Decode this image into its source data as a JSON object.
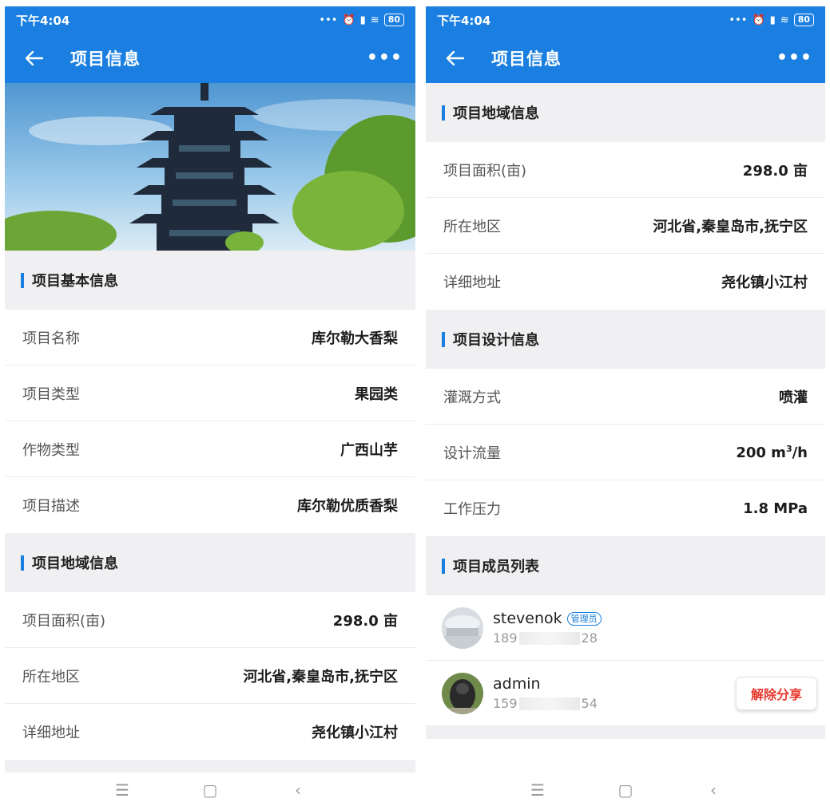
{
  "status_bar": {
    "time": "下午4:04",
    "battery": "80"
  },
  "app_bar": {
    "title": "项目信息"
  },
  "sections": {
    "basic": {
      "title": "项目基本信息",
      "rows": [
        {
          "label": "项目名称",
          "value": "库尔勒大香梨"
        },
        {
          "label": "项目类型",
          "value": "果园类"
        },
        {
          "label": "作物类型",
          "value": "广西山芋"
        },
        {
          "label": "项目描述",
          "value": "库尔勒优质香梨"
        }
      ]
    },
    "region": {
      "title": "项目地域信息",
      "rows": [
        {
          "label": "项目面积(亩)",
          "value": "298.0 亩"
        },
        {
          "label": "所在地区",
          "value": "河北省,秦皇岛市,抚宁区"
        },
        {
          "label": "详细地址",
          "value": "尧化镇小江村"
        }
      ]
    },
    "design": {
      "title": "项目设计信息",
      "rows": [
        {
          "label": "灌溉方式",
          "value": "喷灌"
        },
        {
          "label": "设计流量",
          "value": "200 m",
          "unit_sup": "3",
          "unit_tail": "/h"
        },
        {
          "label": "工作压力",
          "value": "1.8 MPa"
        }
      ]
    },
    "members": {
      "title": "项目成员列表",
      "items": [
        {
          "name": "stevenok",
          "role": "管理员",
          "phone_head": "189",
          "phone_tail": "28"
        },
        {
          "name": "admin",
          "phone_head": "159",
          "phone_tail": "54",
          "action_label": "解除分享"
        }
      ]
    }
  },
  "colors": {
    "primary": "#1a7fe0",
    "danger": "#e8372c"
  },
  "icons": {
    "back": "arrow-left-icon",
    "more": "more-dots-icon",
    "nav_menu": "menu-icon",
    "nav_home": "square-home-icon",
    "nav_back": "chevron-left-icon"
  }
}
